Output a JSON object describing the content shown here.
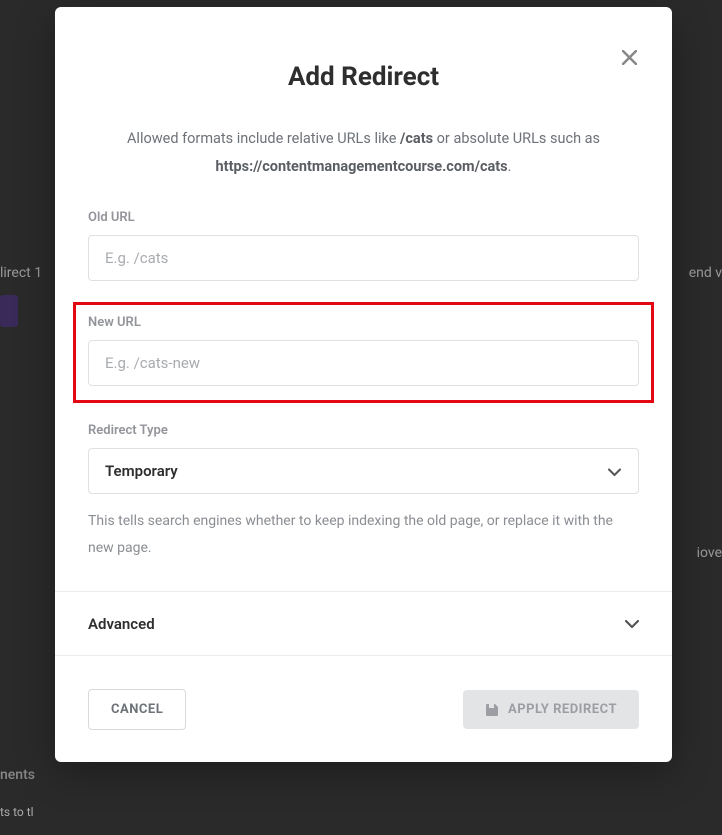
{
  "modal": {
    "title": "Add Redirect",
    "help_text_prefix": "Allowed formats include relative URLs like ",
    "help_text_bold1": "/cats",
    "help_text_mid": " or absolute URLs such as ",
    "help_text_bold2": "https://contentmanagementcourse.com/cats",
    "help_text_suffix": ".",
    "old_url_label": "Old URL",
    "old_url_placeholder": "E.g. /cats",
    "old_url_value": "",
    "new_url_label": "New URL",
    "new_url_placeholder": "E.g. /cats-new",
    "new_url_value": "",
    "redirect_type_label": "Redirect Type",
    "redirect_type_value": "Temporary",
    "redirect_type_help": "This tells search engines whether to keep indexing the old page, or replace it with the new page.",
    "advanced_label": "Advanced",
    "cancel_label": "CANCEL",
    "apply_label": "APPLY REDIRECT"
  },
  "background": {
    "text1": "lirect 1",
    "text2": "end v",
    "text3": "iove",
    "text4": "nents",
    "text5": "ts to tl"
  }
}
